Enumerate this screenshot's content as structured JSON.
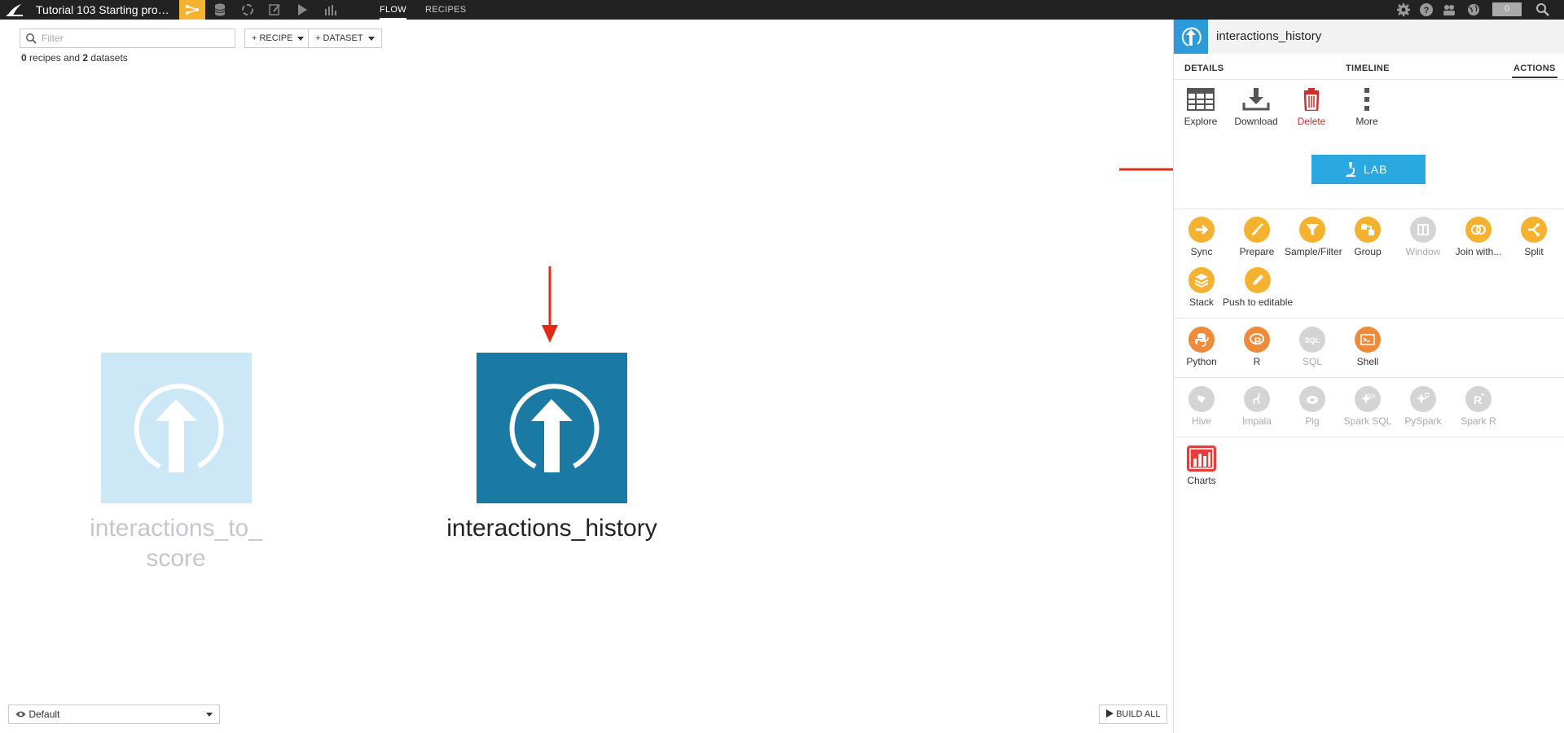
{
  "topbar": {
    "project_title": "Tutorial 103 Starting pro…",
    "tabs": [
      {
        "label": "FLOW",
        "active": true
      },
      {
        "label": "RECIPES",
        "active": false
      }
    ],
    "notification_count": "0",
    "accent_color": "#f5b230"
  },
  "toolbar": {
    "filter_placeholder": "Filter",
    "recipe_button": "+ RECIPE",
    "dataset_button": "+ DATASET",
    "summary": {
      "recipes": "0",
      "recipes_text": " recipes and ",
      "datasets": "2",
      "datasets_text": " datasets"
    }
  },
  "flow": {
    "nodes": [
      {
        "label": "interactions_to_\nscore",
        "line1": "interactions_to_",
        "line2": "score",
        "state": "faded",
        "color": "#cce7f6"
      },
      {
        "label": "interactions_history",
        "state": "selected",
        "color": "#1a7aa3"
      }
    ],
    "annotation_arrow_color": "#e02b15"
  },
  "bottom": {
    "view_select": "Default",
    "build_all": "BUILD ALL"
  },
  "panel": {
    "title": "interactions_history",
    "tabs": [
      "DETAILS",
      "TIMELINE",
      "ACTIONS"
    ],
    "active_tab": "ACTIONS",
    "actions": [
      {
        "label": "Explore",
        "icon": "table-icon"
      },
      {
        "label": "Download",
        "icon": "download-icon"
      },
      {
        "label": "Delete",
        "icon": "trash-icon",
        "color": "#c9302c"
      },
      {
        "label": "More",
        "icon": "more-vertical-icon"
      }
    ],
    "lab_button": "LAB",
    "visual_recipes": [
      {
        "label": "Sync",
        "icon": "sync-icon",
        "enabled": true
      },
      {
        "label": "Prepare",
        "icon": "broom-icon",
        "enabled": true
      },
      {
        "label": "Sample/Filter",
        "icon": "filter-icon",
        "enabled": true
      },
      {
        "label": "Group",
        "icon": "group-icon",
        "enabled": true
      },
      {
        "label": "Window",
        "icon": "window-icon",
        "enabled": false
      },
      {
        "label": "Join with...",
        "icon": "join-icon",
        "enabled": true
      },
      {
        "label": "Split",
        "icon": "split-icon",
        "enabled": true
      },
      {
        "label": "Stack",
        "icon": "stack-icon",
        "enabled": true
      },
      {
        "label": "Push to editable",
        "icon": "pencil-icon",
        "enabled": true
      }
    ],
    "code_recipes": [
      {
        "label": "Python",
        "icon": "python-icon",
        "enabled": true
      },
      {
        "label": "R",
        "icon": "r-icon",
        "enabled": true
      },
      {
        "label": "SQL",
        "icon": "sql-icon",
        "enabled": false
      },
      {
        "label": "Shell",
        "icon": "shell-icon",
        "enabled": true
      }
    ],
    "hadoop_recipes": [
      {
        "label": "Hive",
        "icon": "hive-icon",
        "enabled": false
      },
      {
        "label": "Impala",
        "icon": "impala-icon",
        "enabled": false
      },
      {
        "label": "Pig",
        "icon": "pig-icon",
        "enabled": false
      },
      {
        "label": "Spark SQL",
        "icon": "spark-sql-icon",
        "enabled": false
      },
      {
        "label": "PySpark",
        "icon": "pyspark-icon",
        "enabled": false
      },
      {
        "label": "Spark R",
        "icon": "spark-r-icon",
        "enabled": false
      }
    ],
    "other": [
      {
        "label": "Charts",
        "icon": "charts-icon",
        "enabled": true
      }
    ]
  }
}
